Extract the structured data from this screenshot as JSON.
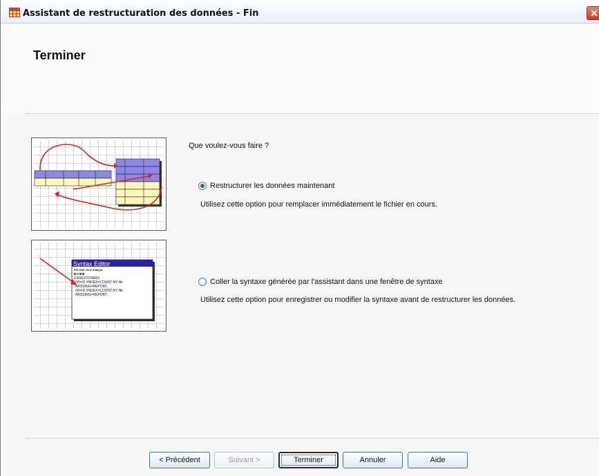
{
  "window": {
    "title": "Assistant de restructuration des données - Fin"
  },
  "page": {
    "title": "Terminer"
  },
  "question": "Que voulez-vous faire ?",
  "options": [
    {
      "label": "Restructurer les données maintenant",
      "description": "Utilisez cette option pour remplacer immédiatement le fichier en cours.",
      "checked": true
    },
    {
      "label": "Coller la syntaxe générée par l'assistant dans une fenêtre de syntaxe",
      "description": "Utilisez cette option pour enregistrer ou modifier la syntaxe avant de restructurer les données.",
      "checked": false
    }
  ],
  "thumb_syntax": {
    "title": "Syntax Editor",
    "menu": "File Edit View Analyze",
    "lines": [
      "CASESTOVARS",
      "/ID=ID /INDEX=COUNT BY file",
      "/MISSING=REPORT.",
      "/ID=ID /INDEX=COUNT BY file",
      "/MISSING=REPORT."
    ]
  },
  "buttons": {
    "previous": "< Précédent",
    "next": "Suivant >",
    "finish": "Terminer",
    "cancel": "Annuler",
    "help": "Aide"
  },
  "colors": {
    "title_bar": "#e9eef7",
    "close": "#c7422b",
    "radio_dot": "#2a62b8",
    "arrow": "#e02020"
  }
}
